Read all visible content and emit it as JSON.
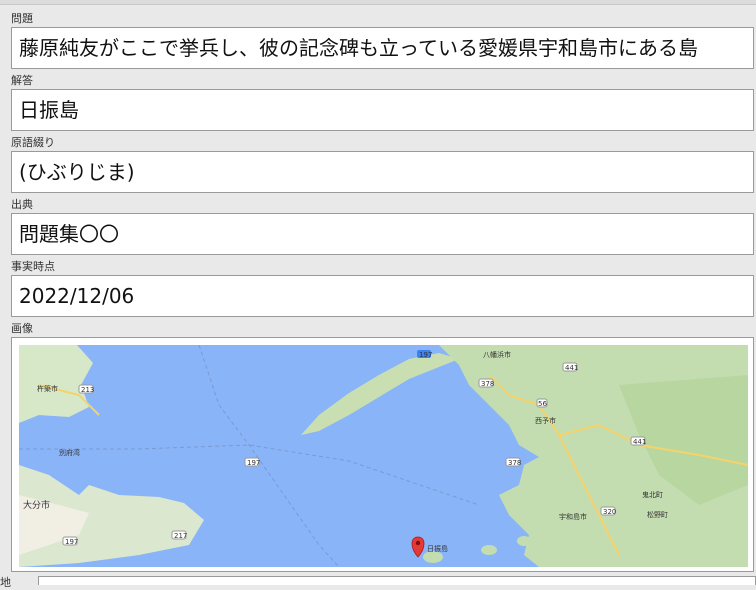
{
  "fields": [
    {
      "label": "問題",
      "value": "藤原純友がここで挙兵し、彼の記念碑も立っている愛媛県宇和島市にある島"
    },
    {
      "label": "解答",
      "value": "日振島"
    },
    {
      "label": "原語綴り",
      "value": "(ひぶりじま)"
    },
    {
      "label": "出典",
      "value": "問題集〇〇"
    },
    {
      "label": "事実時点",
      "value": "2022/12/06"
    }
  ],
  "image": {
    "label": "画像",
    "map_labels": {
      "yawatahama": "八幡浜市",
      "seiyo": "西予市",
      "uwajima": "宇和島市",
      "hiburi": "日振島",
      "oita": "大分市",
      "kinen": "杵築市",
      "beppu": "別府湾",
      "kihoku": "鬼北町",
      "matsuno": "松野町"
    },
    "road_numbers": [
      "197",
      "213",
      "197",
      "378",
      "56",
      "441",
      "378",
      "441",
      "320",
      "217",
      "197"
    ]
  },
  "bottom_label": "地"
}
